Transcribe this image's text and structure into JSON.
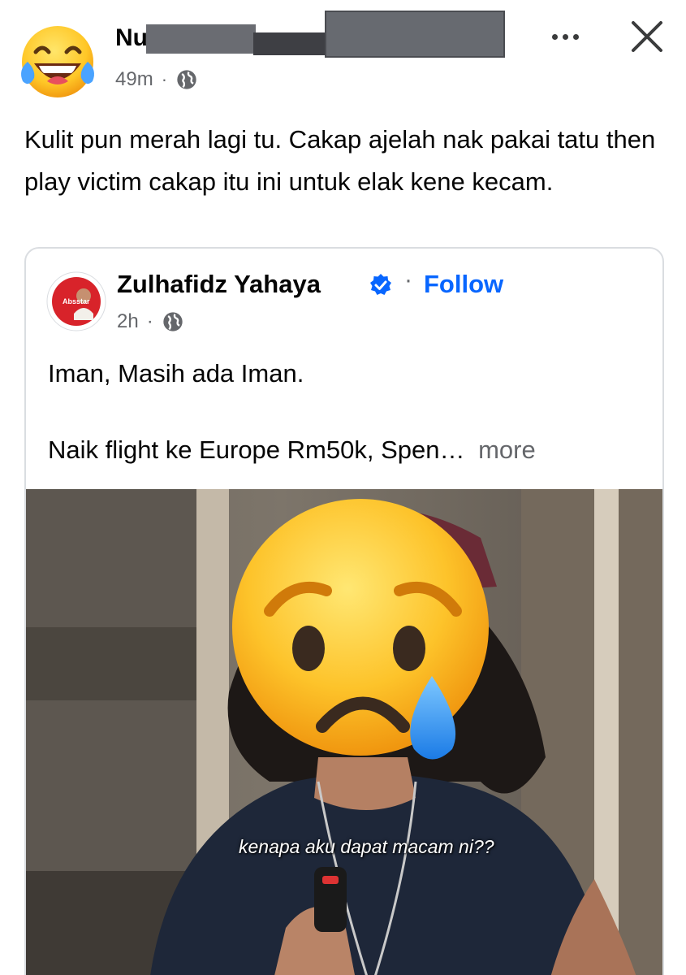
{
  "post": {
    "author_name_visible": "Nu",
    "time": "49m",
    "separator": "·",
    "visibility_icon": "globe-icon",
    "text": "Kulit pun merah lagi tu. Cakap ajelah nak pakai tatu then play victim cakap itu ini untuk elak kene kecam.",
    "actions": {
      "more_icon": "more-horizontal-icon",
      "close_icon": "close-icon"
    },
    "avatar_icon": "laughing-tears-emoji"
  },
  "shared_post": {
    "author": "Zulhafidz Yahaya",
    "verified_icon": "verified-badge-icon",
    "separator": "·",
    "follow_label": "Follow",
    "time": "2h",
    "visibility_icon": "globe-icon",
    "text_line1": "Iman, Masih ada Iman.",
    "text_line2": "Naik flight ke Europe Rm50k, Spen…",
    "see_more": "more",
    "avatar_text": "Absstar",
    "media": {
      "caption": "kenapa aku dapat macam ni??",
      "overlay_icon": "crying-face-emoji"
    }
  },
  "colors": {
    "text_primary": "#050505",
    "text_secondary": "#65676b",
    "link_blue": "#0866ff",
    "border": "#dadde1"
  }
}
